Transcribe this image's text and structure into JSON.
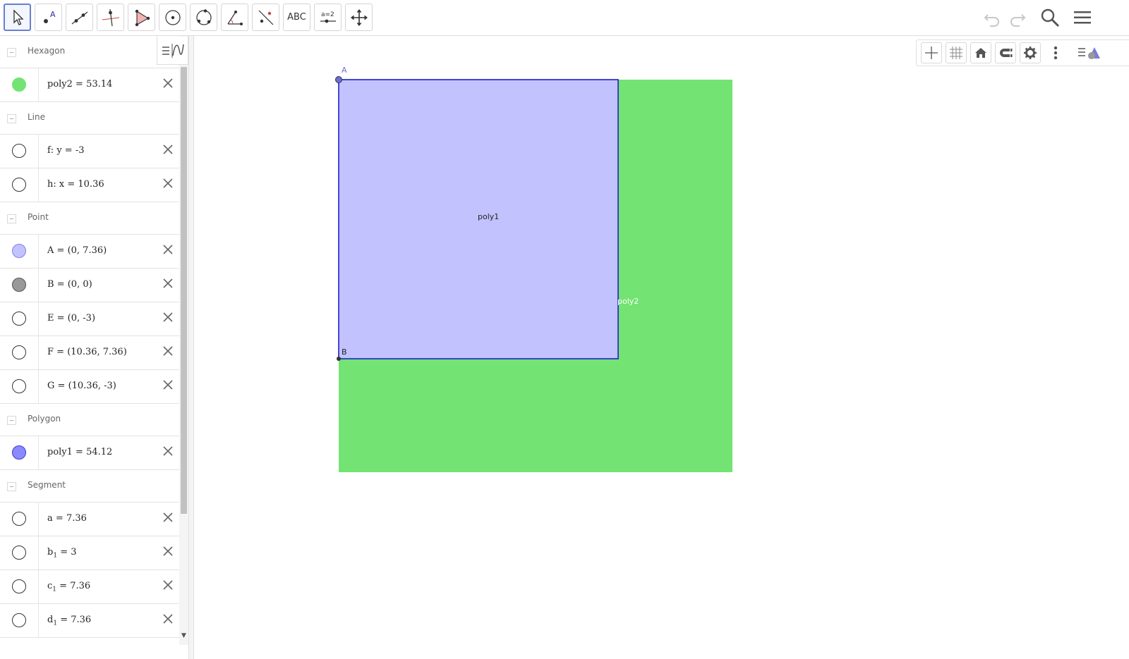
{
  "toolbar": {
    "tools": [
      {
        "id": "move",
        "icon": "move-pointer-icon"
      },
      {
        "id": "point",
        "icon": "point-icon",
        "text": "A"
      },
      {
        "id": "line",
        "icon": "line-through-two-points-icon"
      },
      {
        "id": "perpendicular",
        "icon": "perpendicular-line-icon"
      },
      {
        "id": "polygon",
        "icon": "polygon-icon"
      },
      {
        "id": "circle-center",
        "icon": "circle-with-center-icon"
      },
      {
        "id": "circle-three-points",
        "icon": "circle-through-three-points-icon"
      },
      {
        "id": "angle",
        "icon": "angle-icon"
      },
      {
        "id": "reflect",
        "icon": "reflect-about-line-icon"
      },
      {
        "id": "text",
        "icon": "text-icon",
        "text": "ABC"
      },
      {
        "id": "slider",
        "icon": "slider-icon",
        "text": "a=2"
      },
      {
        "id": "move-view",
        "icon": "move-graphics-view-icon"
      }
    ],
    "right": [
      "undo-icon",
      "redo-icon",
      "search-icon",
      "menu-icon"
    ]
  },
  "algebra": {
    "groups": [
      {
        "label": "Hexagon",
        "items": [
          {
            "name": "poly2",
            "value": "53.14",
            "fill": "#73e373",
            "stroke": "#73e373"
          }
        ]
      },
      {
        "label": "Line",
        "items": [
          {
            "name": "f: y",
            "value": "-3",
            "fill": "#ffffff",
            "stroke": "#333333"
          },
          {
            "name": "h: x",
            "value": "10.36",
            "fill": "#ffffff",
            "stroke": "#333333"
          }
        ]
      },
      {
        "label": "Point",
        "items": [
          {
            "name": "A",
            "value": "(0, 7.36)",
            "fill": "#c2c2ff",
            "stroke": "#8080e6"
          },
          {
            "name": "B",
            "value": "(0, 0)",
            "fill": "#999999",
            "stroke": "#555555"
          },
          {
            "name": "E",
            "value": "(0, -3)",
            "fill": "#ffffff",
            "stroke": "#333333"
          },
          {
            "name": "F",
            "value": "(10.36, 7.36)",
            "fill": "#ffffff",
            "stroke": "#333333"
          },
          {
            "name": "G",
            "value": "(10.36, -3)",
            "fill": "#ffffff",
            "stroke": "#333333"
          }
        ]
      },
      {
        "label": "Polygon",
        "items": [
          {
            "name": "poly1",
            "value": "54.12",
            "fill": "#8a8aff",
            "stroke": "#3a3ad0"
          }
        ]
      },
      {
        "label": "Segment",
        "items": [
          {
            "name": "a",
            "value": "7.36",
            "fill": "#ffffff",
            "stroke": "#333333"
          },
          {
            "name": "b",
            "sub": "1",
            "value": "3",
            "fill": "#ffffff",
            "stroke": "#333333"
          },
          {
            "name": "c",
            "sub": "1",
            "value": "7.36",
            "fill": "#ffffff",
            "stroke": "#333333"
          },
          {
            "name": "d",
            "sub": "1",
            "value": "7.36",
            "fill": "#ffffff",
            "stroke": "#333333"
          }
        ]
      }
    ]
  },
  "graphics": {
    "labels": {
      "A": "A",
      "B": "B",
      "poly1": "poly1",
      "poly2": "poly2"
    },
    "colors": {
      "poly1_fill": "#c2c2ff",
      "poly1_stroke": "#1f1fc8",
      "poly2_fill": "#73e373",
      "point": "#6d6dd6"
    },
    "toolbar": [
      "axes-icon",
      "grid-icon",
      "home-icon",
      "magnet-icon",
      "gear-icon",
      "more-vertical-icon",
      "style-bar-toggle-icon"
    ]
  }
}
